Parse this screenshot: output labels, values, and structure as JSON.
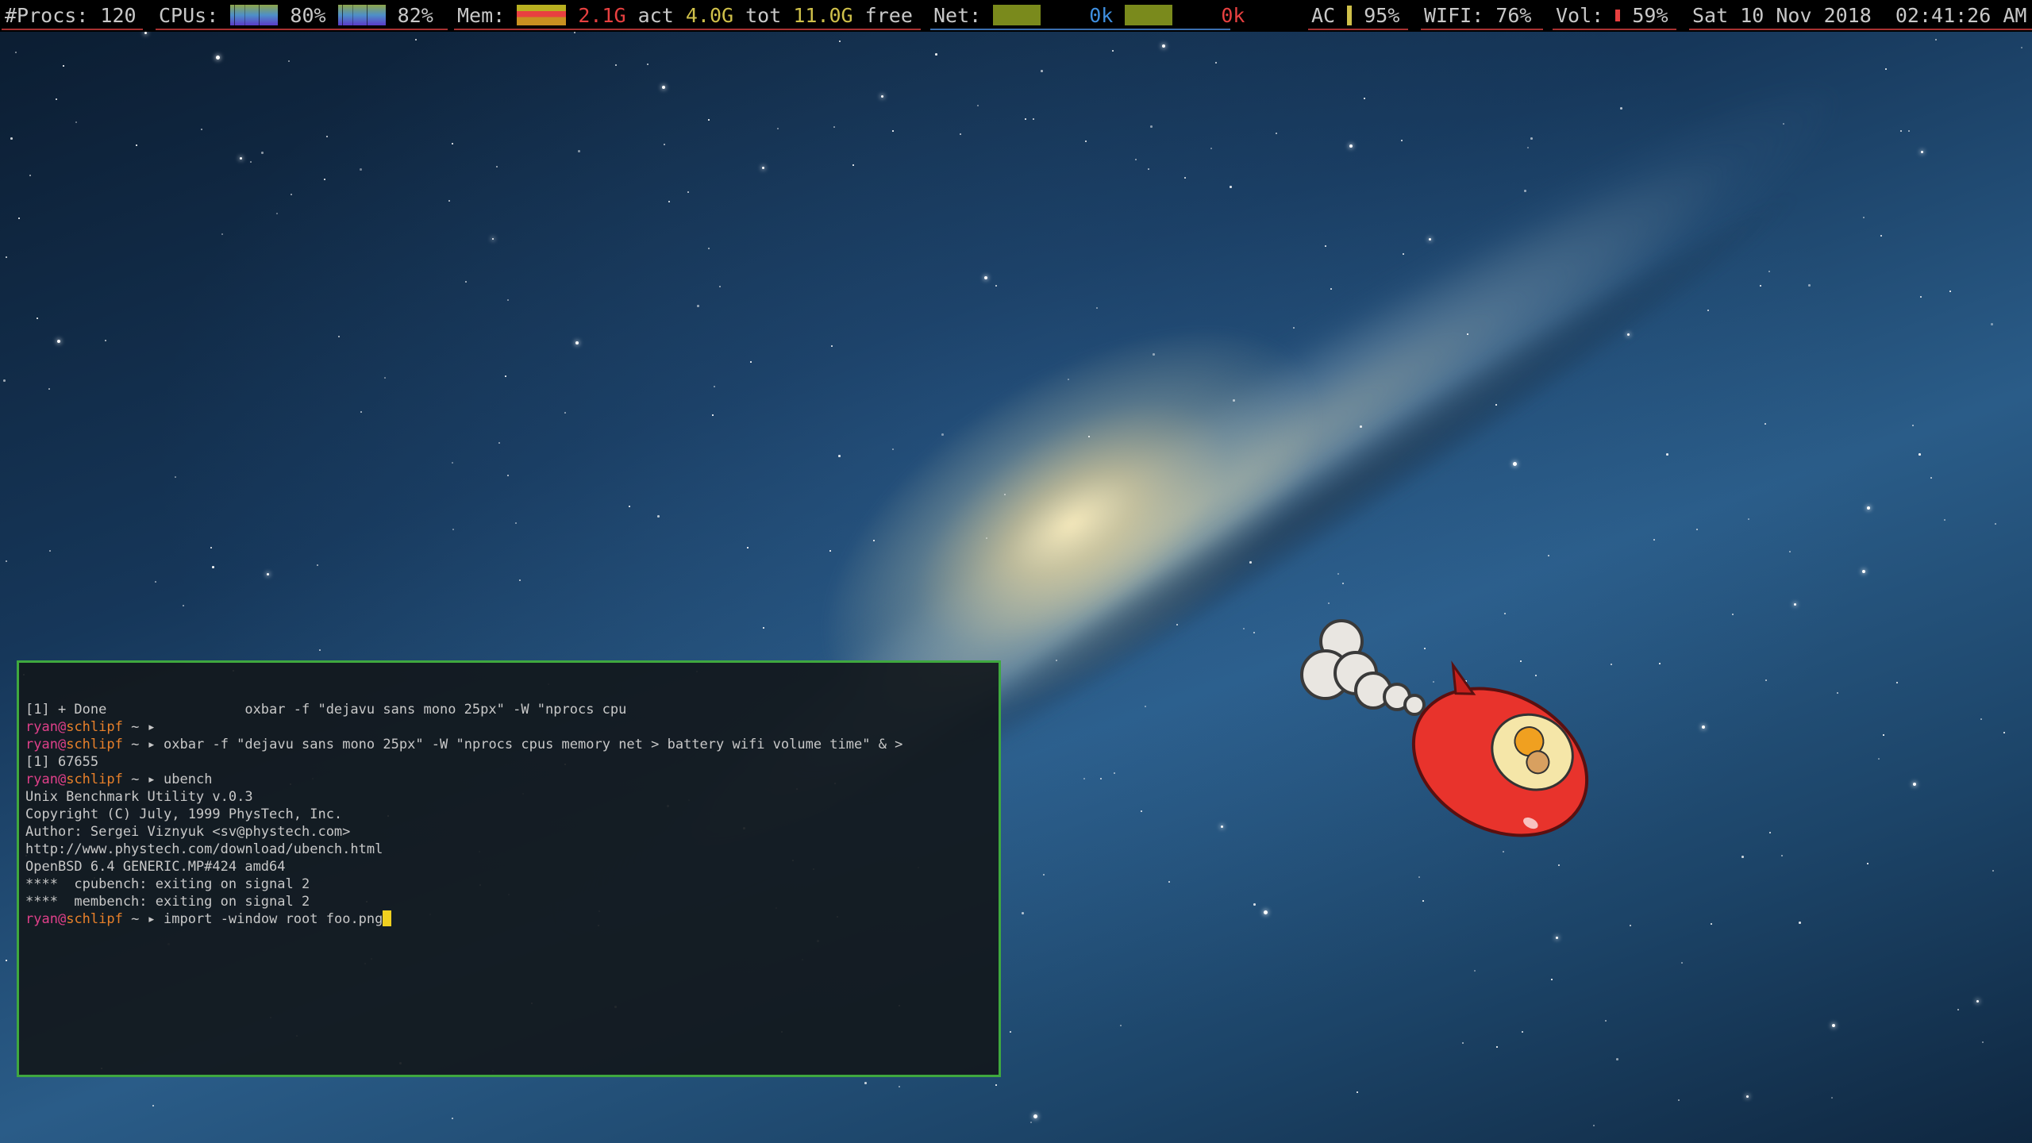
{
  "statusbar": {
    "procs_label": "#Procs:",
    "procs_value": "120",
    "cpus_label": "CPUs:",
    "cpu1_value": "80%",
    "cpu2_value": "82%",
    "mem_label": "Mem:",
    "mem_active": "2.1G",
    "mem_active_label": "act",
    "mem_total": "4.0G",
    "mem_total_label": "tot",
    "mem_free": "11.0G",
    "mem_free_label": "free",
    "net_label": "Net:",
    "net_in": "0k",
    "net_out": "0k",
    "ac_label": "AC",
    "battery_value": "95%",
    "battery_level": 0.95,
    "wifi_label": "WIFI:",
    "wifi_value": "76%",
    "vol_label": "Vol:",
    "vol_value": "59%",
    "volume_level": 0.59,
    "datetime": "Sat 10 Nov 2018  02:41:26 AM"
  },
  "terminal": {
    "prompt_user": "ryan",
    "prompt_host": "schlipf",
    "prompt_sep": "@",
    "prompt_tail": " ~ ▸ ",
    "lines": [
      {
        "kind": "text",
        "text": "[1] + Done                 oxbar -f \"dejavu sans mono 25px\" -W \"nprocs cpu"
      },
      {
        "kind": "prompt",
        "cmd": ""
      },
      {
        "kind": "prompt",
        "cmd": "oxbar -f \"dejavu sans mono 25px\" -W \"nprocs cpus memory net > battery wifi volume time\" & >"
      },
      {
        "kind": "text",
        "text": "[1] 67655"
      },
      {
        "kind": "prompt",
        "cmd": "ubench"
      },
      {
        "kind": "text",
        "text": "Unix Benchmark Utility v.0.3"
      },
      {
        "kind": "text",
        "text": "Copyright (C) July, 1999 PhysTech, Inc."
      },
      {
        "kind": "text",
        "text": "Author: Sergei Viznyuk <sv@phystech.com>"
      },
      {
        "kind": "text",
        "text": "http://www.phystech.com/download/ubench.html"
      },
      {
        "kind": "text",
        "text": "OpenBSD 6.4 GENERIC.MP#424 amd64"
      },
      {
        "kind": "text",
        "text": "****  cpubench: exiting on signal 2"
      },
      {
        "kind": "text",
        "text": "****  membench: exiting on signal 2"
      },
      {
        "kind": "prompt",
        "cmd": "import -window root foo.png",
        "cursor": true
      }
    ]
  },
  "colors": {
    "terminal_border": "#3fa83f",
    "prompt_user": "#e0408a",
    "prompt_host": "#e8802a",
    "cursor": "#f0d020",
    "status_red": "#e84040",
    "status_yellow": "#cfc04a",
    "status_blue": "#3f8fe0"
  },
  "wallpaper": {
    "subject": "spiral galaxy starfield with cartoon red rocket ship",
    "rocket_icon": "rocket-icon"
  }
}
